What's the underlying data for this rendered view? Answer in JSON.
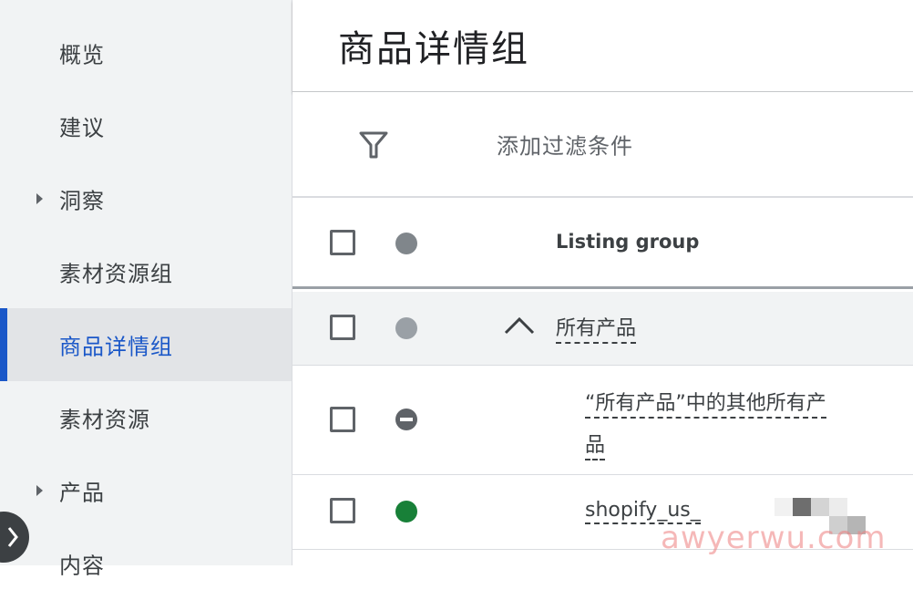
{
  "sidebar": {
    "items": [
      {
        "label": "概览",
        "has_caret": false
      },
      {
        "label": "建议",
        "has_caret": false
      },
      {
        "label": "洞察",
        "has_caret": true
      },
      {
        "label": "素材资源组",
        "has_caret": false
      },
      {
        "label": "商品详情组",
        "has_caret": false,
        "active": true
      },
      {
        "label": "素材资源",
        "has_caret": false
      },
      {
        "label": "产品",
        "has_caret": true
      },
      {
        "label": "内容",
        "has_caret": false
      }
    ]
  },
  "header": {
    "title": "商品详情组"
  },
  "filter": {
    "label": "添加过滤条件",
    "icon": "filter-icon"
  },
  "table": {
    "column_header": "Listing group",
    "rows": [
      {
        "text": "所有产品",
        "status": "gray",
        "expanded": true
      },
      {
        "text_line1": "“所有产品”中的其他所有产",
        "text_line2": "品",
        "status": "excluded"
      },
      {
        "text": "shopify_us_",
        "status": "active"
      }
    ]
  },
  "colors": {
    "accent": "#1a57c8",
    "status_active": "#188038",
    "status_gray": "#9aa0a6",
    "status_header": "#80868b"
  },
  "watermark": "awyerwu.com"
}
